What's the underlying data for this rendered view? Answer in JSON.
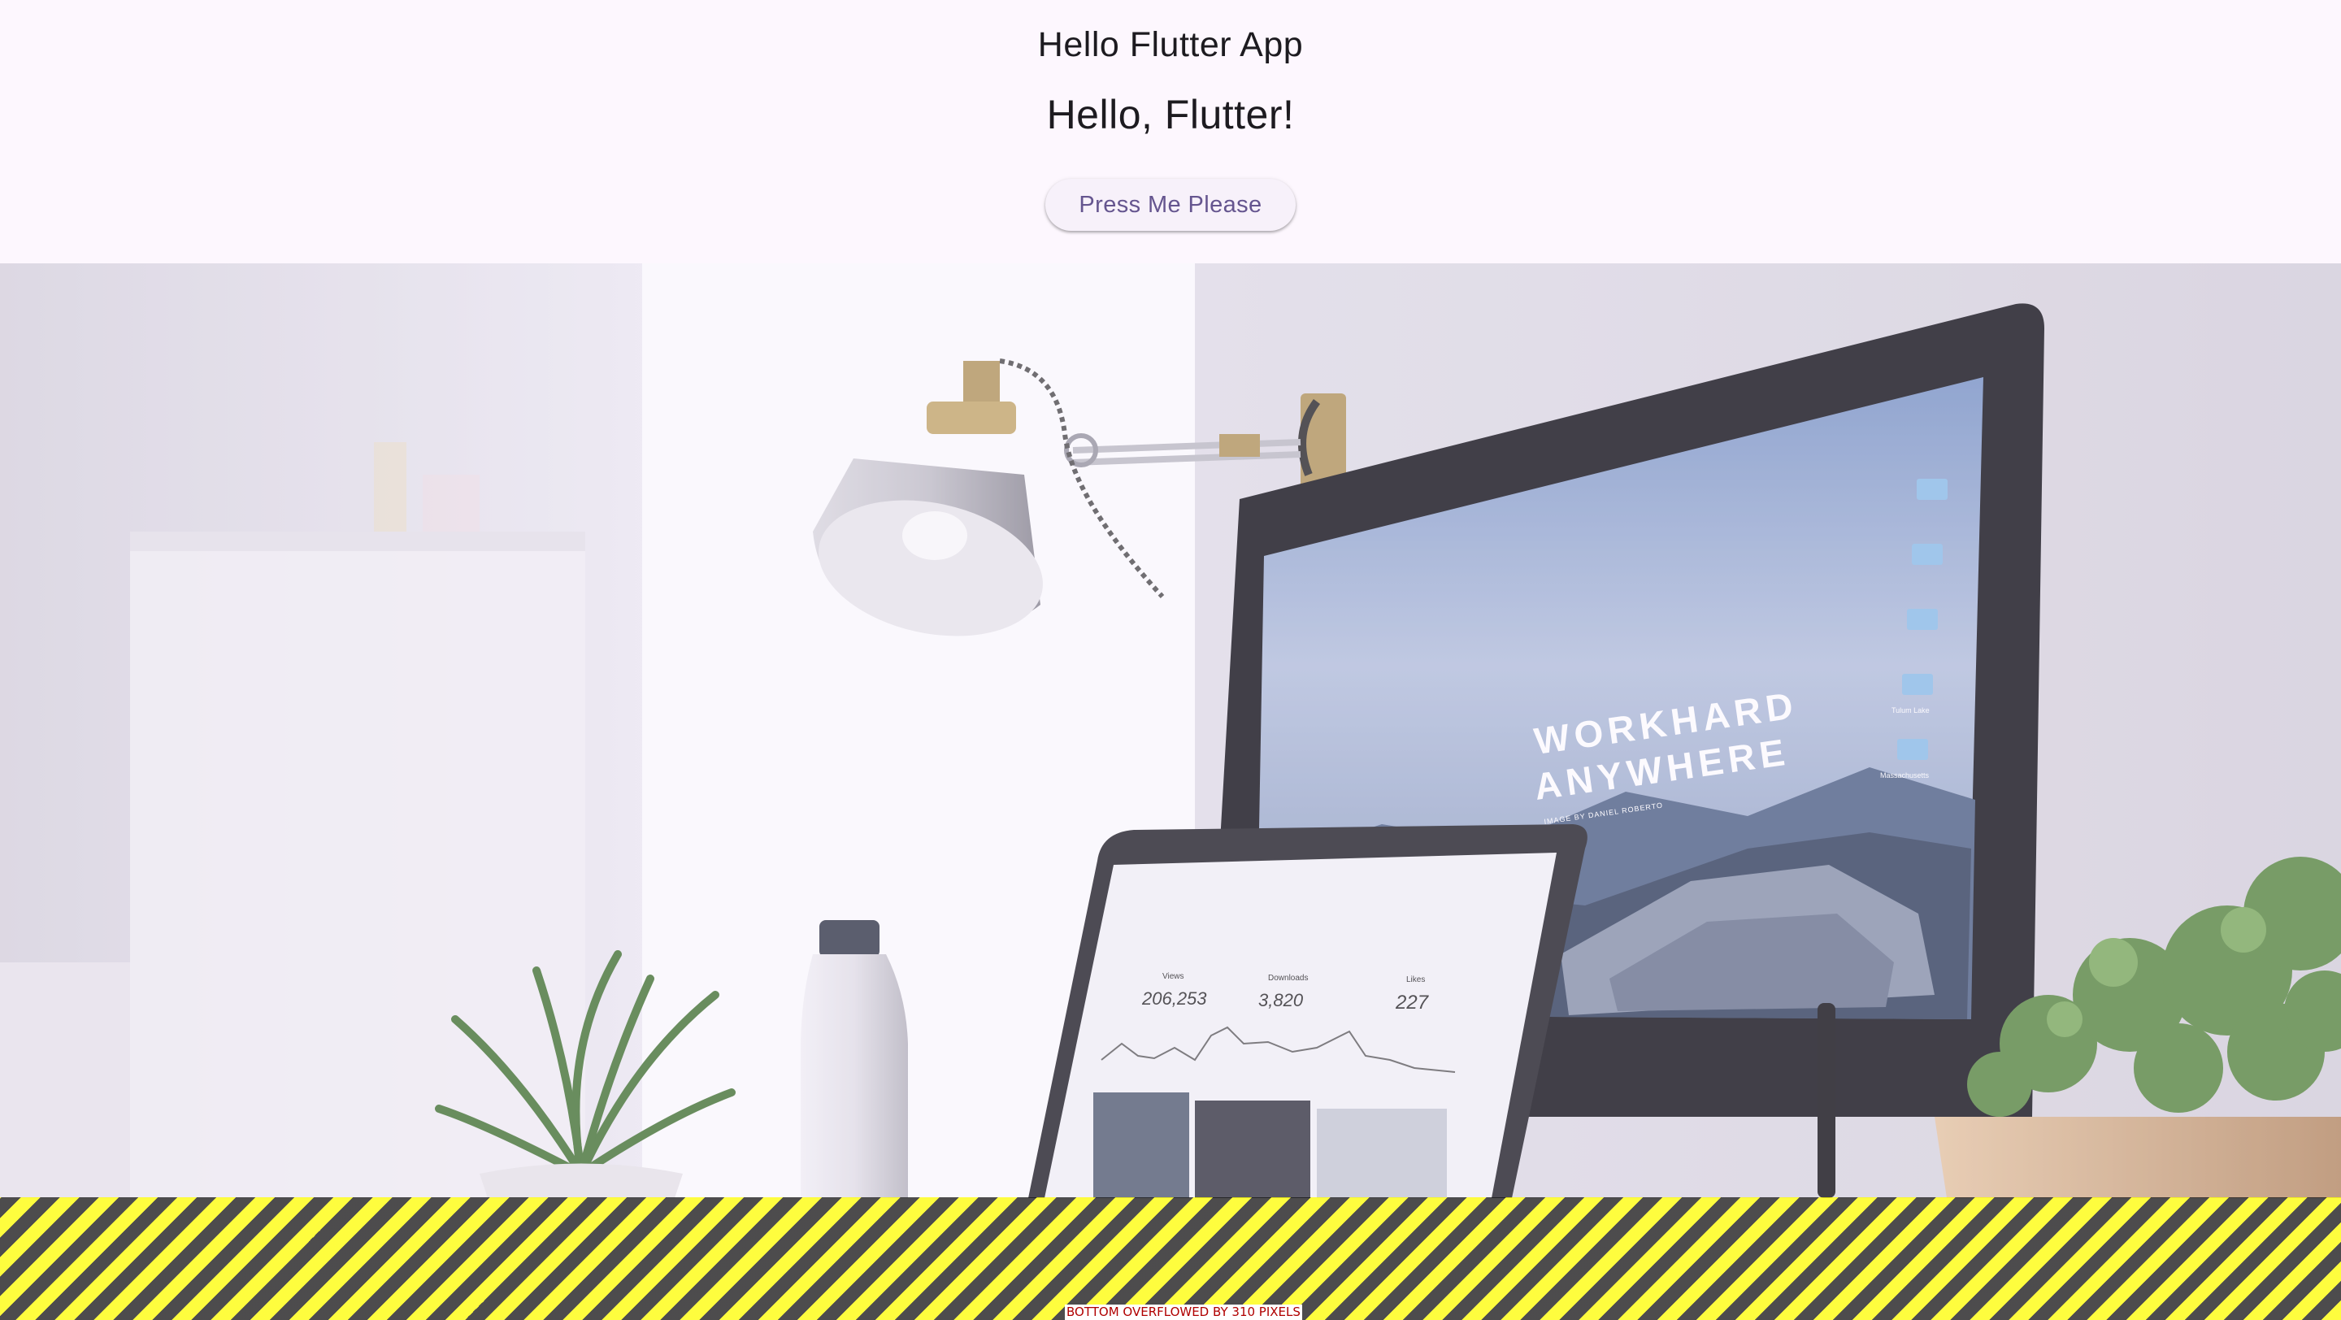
{
  "appbar": {
    "title": "Hello Flutter App"
  },
  "main": {
    "heading": "Hello, Flutter!",
    "button_label": "Press Me Please"
  },
  "photo": {
    "screen_headline_line1": "WORKHARD",
    "screen_headline_line2": "ANYWHERE",
    "screen_credit": "IMAGE BY DANIEL ROBERTO",
    "desktop_folder_1": "Tulum Lake",
    "desktop_folder_2": "Massachusetts",
    "laptop_stats": [
      {
        "label": "Views",
        "value": "206,253"
      },
      {
        "label": "Downloads",
        "value": "3,820"
      },
      {
        "label": "Likes",
        "value": "227"
      }
    ]
  },
  "debug": {
    "overflow_message": "BOTTOM OVERFLOWED BY 310 PIXELS"
  },
  "colors": {
    "background": "#fdf7fe",
    "button_text": "#65558f",
    "overflow_yellow": "#ffff00",
    "overflow_text": "#b00000"
  }
}
